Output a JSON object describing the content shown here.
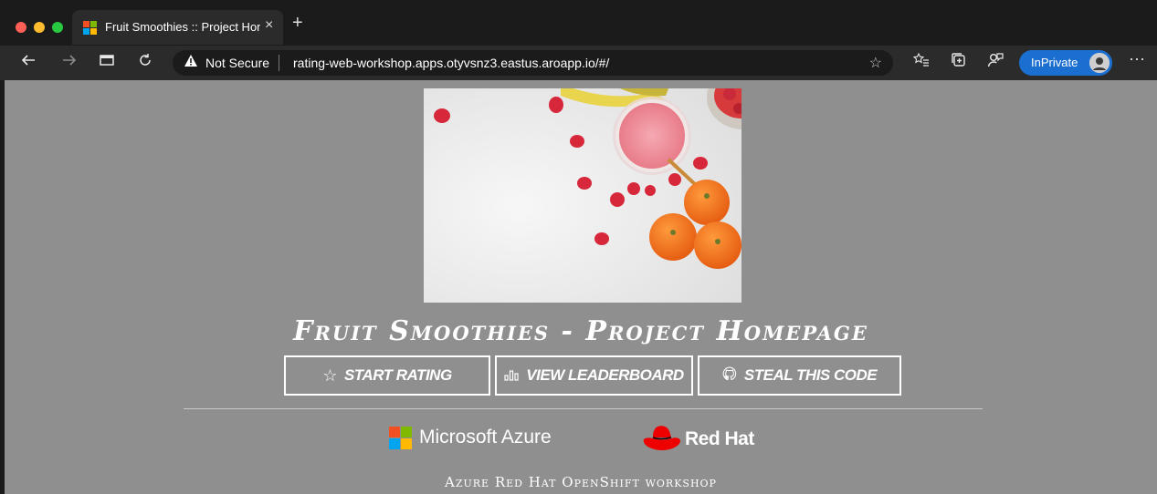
{
  "browser": {
    "tab": {
      "title": "Fruit Smoothies :: Project Homepage",
      "close_icon": "×"
    },
    "new_tab_icon": "+",
    "address": {
      "security_label": "Not Secure",
      "url": "rating-web-workshop.apps.otyvsnz3.eastus.aroapp.io/#/"
    },
    "inprivate_label": "InPrivate",
    "colors": {
      "close": "#ff5f57",
      "minimize": "#febc2e",
      "zoom": "#28c840",
      "inprivate": "#1a6fd0"
    }
  },
  "page": {
    "headline": "Fruit Smoothies - Project Homepage",
    "buttons": [
      {
        "label": "Start Rating",
        "icon": "star-outline-icon"
      },
      {
        "label": "View Leaderboard",
        "icon": "bar-chart-icon"
      },
      {
        "label": "Steal This Code",
        "icon": "github-icon"
      }
    ],
    "logos": {
      "microsoft": "Microsoft Azure",
      "redhat": "Red Hat"
    },
    "footer": "Azure Red Hat OpenShift workshop",
    "background": "#8f8f8f"
  }
}
